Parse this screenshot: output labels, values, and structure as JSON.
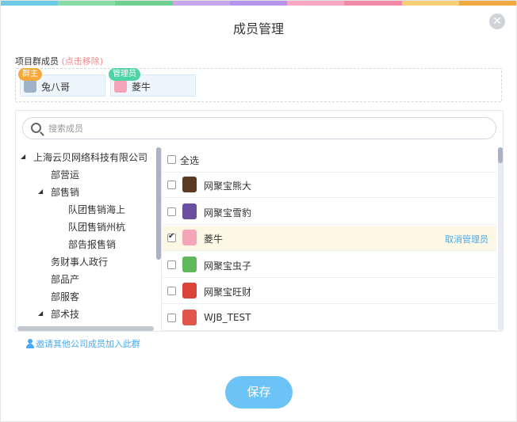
{
  "colors": {
    "rainbow": [
      "#6ec9e5",
      "#87dca6",
      "#6fd18d",
      "#c7a7e8",
      "#b694ec",
      "#f7a8c4",
      "#f08aa6",
      "#f6cf77",
      "#f2a841"
    ],
    "accent": "#49a9ee",
    "save_button": "#6cc3f6",
    "owner_tag": "#f7a93b",
    "admin_tag": "#4ed3a6"
  },
  "dialog": {
    "title": "成员管理",
    "close_icon": "close-icon"
  },
  "members": {
    "label": "项目群成员",
    "hint": "(点击移除)",
    "chips": [
      {
        "name": "兔八哥",
        "tag": "群主",
        "avatar_icon": "bunny-avatar-icon"
      },
      {
        "name": "菱牛",
        "tag": "管理员",
        "avatar_icon": "girl-avatar-icon"
      }
    ]
  },
  "search": {
    "placeholder": "搜索成员"
  },
  "tree": {
    "items": [
      {
        "label": "上海云贝网络科技有限公司",
        "expanded": true
      },
      {
        "label": "部营运"
      },
      {
        "label": "部售销",
        "expanded": true
      },
      {
        "label": "队团售销海上"
      },
      {
        "label": "队团售销州杭"
      },
      {
        "label": "部告报售销"
      },
      {
        "label": "务财事人政行"
      },
      {
        "label": "部品产"
      },
      {
        "label": "部服客"
      },
      {
        "label": "部术技",
        "expanded": true
      }
    ]
  },
  "list": {
    "select_all": "全选",
    "rows": [
      {
        "name": "网聚宝熊大",
        "checked": false,
        "avatar_icon": "bear-avatar-icon"
      },
      {
        "name": "网聚宝雪豹",
        "checked": false,
        "avatar_icon": "leopard-avatar-icon"
      },
      {
        "name": "菱牛",
        "checked": true,
        "avatar_icon": "girl-avatar-icon",
        "action": "取消管理员"
      },
      {
        "name": "网聚宝虫子",
        "checked": false,
        "avatar_icon": "bug-avatar-icon"
      },
      {
        "name": "网聚宝旺财",
        "checked": false,
        "avatar_icon": "dog-avatar-icon"
      },
      {
        "name": "WJB_TEST",
        "checked": false,
        "avatar_icon": "crab-avatar-icon"
      }
    ]
  },
  "invite": {
    "label": "邀请其他公司成员加入此群"
  },
  "save": {
    "label": "保存"
  }
}
